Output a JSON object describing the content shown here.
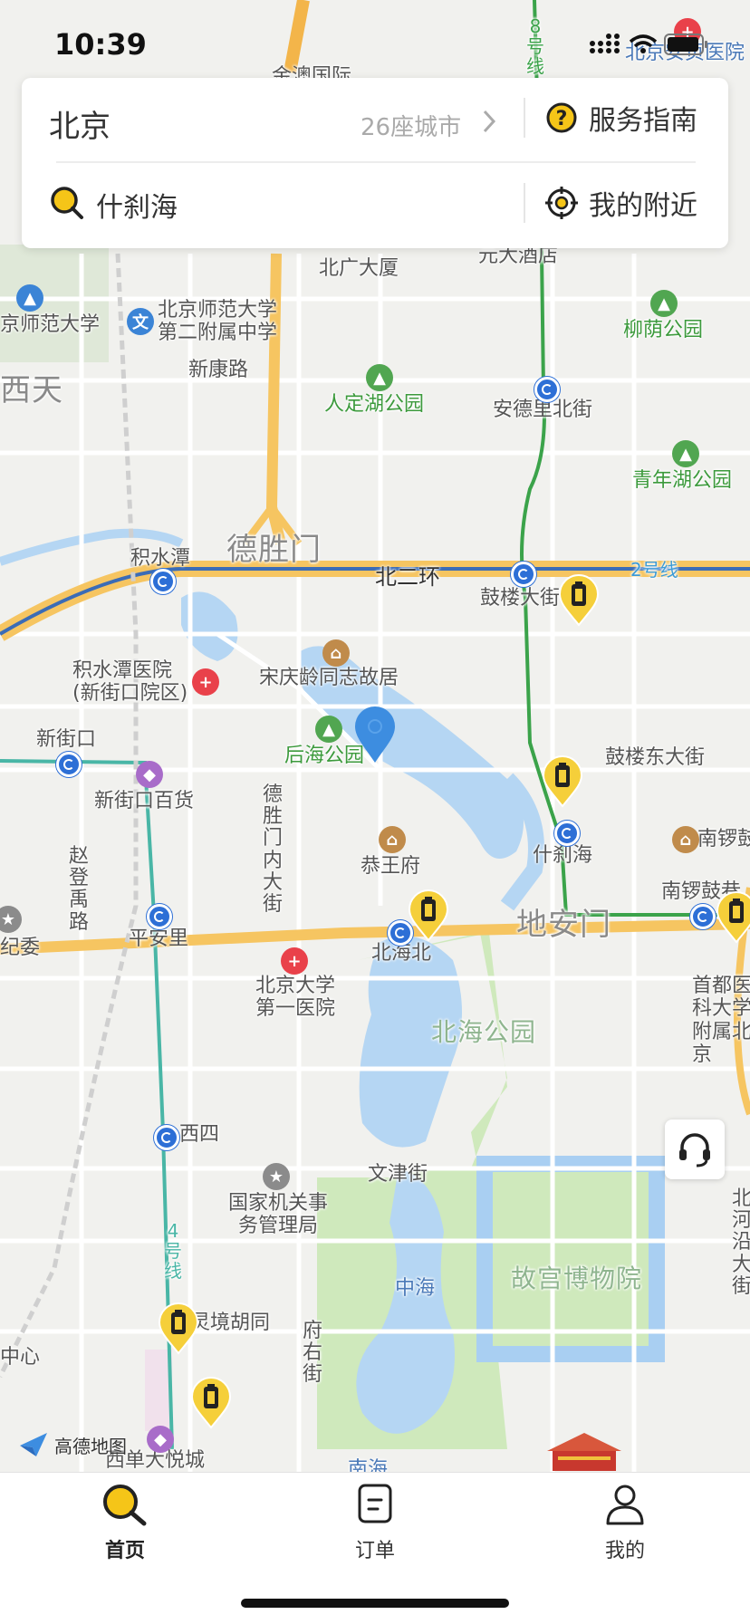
{
  "status_bar": {
    "time": "10:39"
  },
  "search_card": {
    "city": "北京",
    "city_count": "26座城市",
    "service_guide": "服务指南",
    "search_text": "什刹海",
    "nearby": "我的附近"
  },
  "map": {
    "attribution": "高德地图",
    "labels": {
      "anzhen": "北京安贞医院",
      "jinding": "金澳国际",
      "beiguang": "北广大厦",
      "yuanda": "元大酒店",
      "line8": "8号线",
      "bnu": "京师范大学",
      "bnu2": "北京师范大学第二附属中学",
      "liuyin": "柳荫公园",
      "xikang": "新康路",
      "xitian": "西天",
      "rendinghu": "人定湖公园",
      "andelibei": "安德里北街",
      "qingnianhu": "青年湖公园",
      "jishuitan": "积水潭",
      "deshengmen": "德胜门",
      "beierhuan": "北二环",
      "line2": "2号线",
      "guloudajie": "鼓楼大街",
      "jstyy": "积水潭医院(新街口院区)",
      "songqingling": "宋庆龄同志故居",
      "xinjiekou": "新街口",
      "houhai": "后海公园",
      "guloudong": "鼓楼东大街",
      "xjkbh": "新街口百货",
      "dsmn": "德胜门内大街",
      "gongwangfu": "恭王府",
      "shichahai": "什刹海",
      "nanluo": "南锣鼓巷",
      "nanluo2": "南锣鼓巷",
      "zhaodeng": "赵登禹路",
      "jiwei": "纪委",
      "pinganli": "平安里",
      "beihaibei": "北海北",
      "dianmen": "地安门",
      "pku1": "北京大学第一医院",
      "shoudu": "首都医科大学附属北京",
      "beihaipark": "北海公园",
      "xisi": "西四",
      "wenjin": "文津街",
      "guojiju": "国家机关事务管理局",
      "line4": "4号线",
      "zhonghai": "中海",
      "gugong": "故宫博物院",
      "beiheyan": "北河沿大街",
      "lingjing": "灵境胡同",
      "zhongxin": "中心",
      "fuyou": "府右街",
      "xidan": "西单大悦城",
      "nanhai": "南海"
    }
  },
  "tabs": [
    {
      "label": "首页",
      "icon": "search-icon",
      "active": true
    },
    {
      "label": "订单",
      "icon": "order-icon",
      "active": false
    },
    {
      "label": "我的",
      "icon": "profile-icon",
      "active": false
    }
  ],
  "colors": {
    "brand": "#f5c518",
    "metro_line2": "#3b6cb6",
    "metro_line8": "#3ba34a",
    "metro_line4": "#49b6a6",
    "water": "#b5d6f3",
    "park": "#cde9b9"
  }
}
